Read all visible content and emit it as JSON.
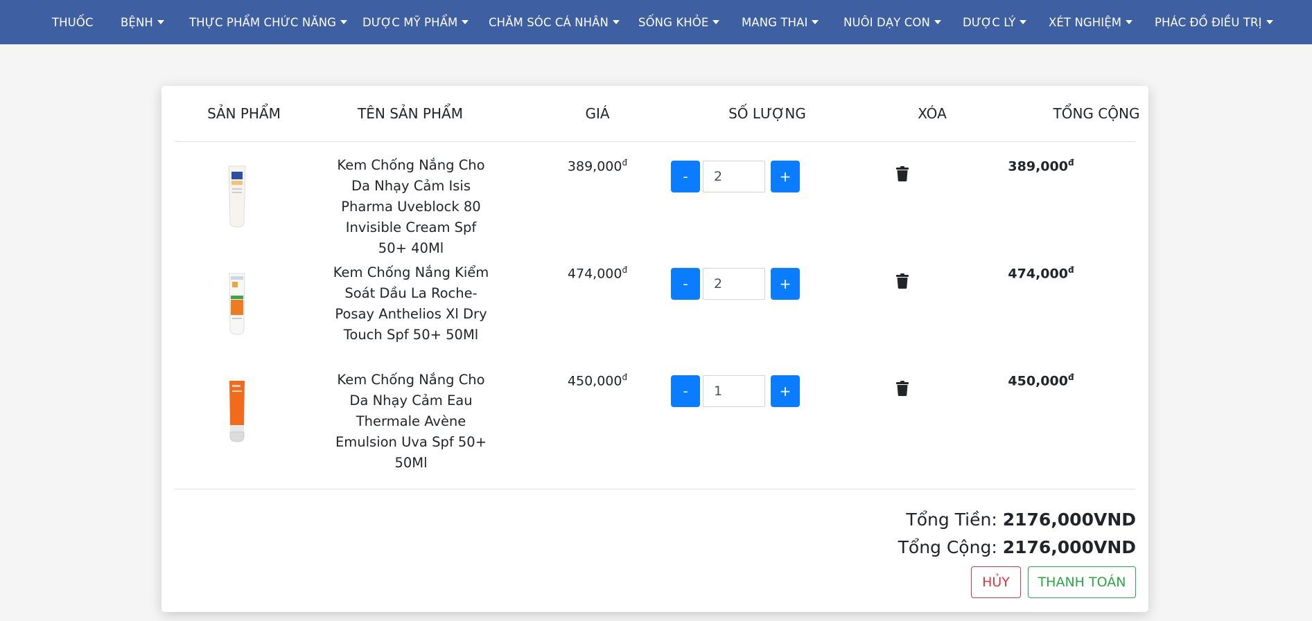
{
  "nav": {
    "items": [
      {
        "label": "THUỐC",
        "dropdown": false
      },
      {
        "label": "BỆNH",
        "dropdown": true
      },
      {
        "label": "THỰC PHẨM CHỨC NĂNG",
        "dropdown": true
      },
      {
        "label": "DƯỢC MỸ PHẨM",
        "dropdown": true
      },
      {
        "label": "CHĂM SÓC CÁ NHÂN",
        "dropdown": true
      },
      {
        "label": "SỐNG KHỎE",
        "dropdown": true
      },
      {
        "label": "MANG THAI",
        "dropdown": true
      },
      {
        "label": "NUÔI DẠY CON",
        "dropdown": true
      },
      {
        "label": "DƯỢC LÝ",
        "dropdown": true
      },
      {
        "label": "XÉT NGHIỆM",
        "dropdown": true
      },
      {
        "label": "PHÁC ĐỒ ĐIỀU TRỊ",
        "dropdown": true
      }
    ]
  },
  "cart": {
    "headers": [
      "SẢN PHẨM",
      "TÊN SẢN PHẨM",
      "GIÁ",
      "SỐ LƯỢNG",
      "XÓA",
      "TỔNG CỘNG"
    ],
    "currency_symbol": "đ",
    "minus_label": "-",
    "plus_label": "+",
    "rows": [
      {
        "name": "Kem Chống Nắng Cho Da Nhạy Cảm Isis Pharma Uveblock 80 Invisible Cream Spf 50+ 40Ml",
        "price": "389,000",
        "qty": "2",
        "total": "389,000",
        "image": "white-tube-icon"
      },
      {
        "name": "Kem Chống Nắng Kiểm Soát Dầu La Roche-Posay Anthelios Xl Dry Touch Spf 50+ 50Ml",
        "price": "474,000",
        "qty": "2",
        "total": "474,000",
        "image": "white-orange-tube-icon"
      },
      {
        "name": "Kem Chống Nắng Cho Da Nhạy Cảm Eau Thermale Avène Emulsion Uva Spf 50+ 50Ml",
        "price": "450,000",
        "qty": "1",
        "total": "450,000",
        "image": "orange-tube-icon"
      }
    ]
  },
  "summary": {
    "subtotal_label": "Tổng Tiền:",
    "subtotal_value": "2176,000VND",
    "total_label": "Tổng Cộng:",
    "total_value": "2176,000VND",
    "cancel_label": "HỦY",
    "checkout_label": "THANH TOÁN"
  },
  "colors": {
    "navbar": "#3f5fa3",
    "primary": "#0a7cff",
    "danger": "#dc3545",
    "success": "#28a745"
  }
}
